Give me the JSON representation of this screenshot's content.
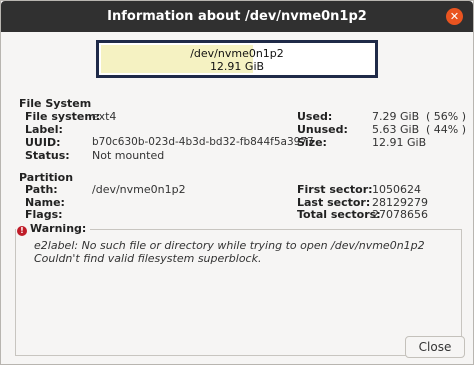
{
  "window": {
    "title": "Information about /dev/nvme0n1p2",
    "close_glyph": "✕"
  },
  "usage_bar": {
    "path": "/dev/nvme0n1p2",
    "size": "12.91 GiB",
    "used_fraction": 0.56
  },
  "filesystem": {
    "section_title": "File System",
    "labels": {
      "filesystem": "File system:",
      "label": "Label:",
      "uuid": "UUID:",
      "status": "Status:",
      "used": "Used:",
      "unused": "Unused:",
      "size": "Size:"
    },
    "values": {
      "filesystem": "ext4",
      "uuid": "b70c630b-023d-4b3d-bd32-fb844f5a3977",
      "status": "Not mounted",
      "used": "7.29 GiB",
      "used_pct": "( 56% )",
      "unused": "5.63 GiB",
      "unused_pct": "( 44% )",
      "size": "12.91 GiB"
    }
  },
  "partition": {
    "section_title": "Partition",
    "labels": {
      "path": "Path:",
      "name": "Name:",
      "flags": "Flags:",
      "first_sector": "First sector:",
      "last_sector": "Last sector:",
      "total_sectors": "Total sectors:"
    },
    "values": {
      "path": "/dev/nvme0n1p2",
      "first_sector": "1050624",
      "last_sector": "28129279",
      "total_sectors": "27078656"
    }
  },
  "warning": {
    "title": "Warning:",
    "icon_glyph": "!",
    "lines": [
      "e2label: No such file or directory while trying to open /dev/nvme0n1p2",
      "Couldn't find valid filesystem superblock."
    ]
  },
  "buttons": {
    "close": "Close"
  },
  "colors": {
    "titlebar": "#303030",
    "close_accent": "#e95420",
    "usage_border": "#1f2a48",
    "usage_fill": "#f5f2c2",
    "warning_icon": "#c01c28"
  }
}
